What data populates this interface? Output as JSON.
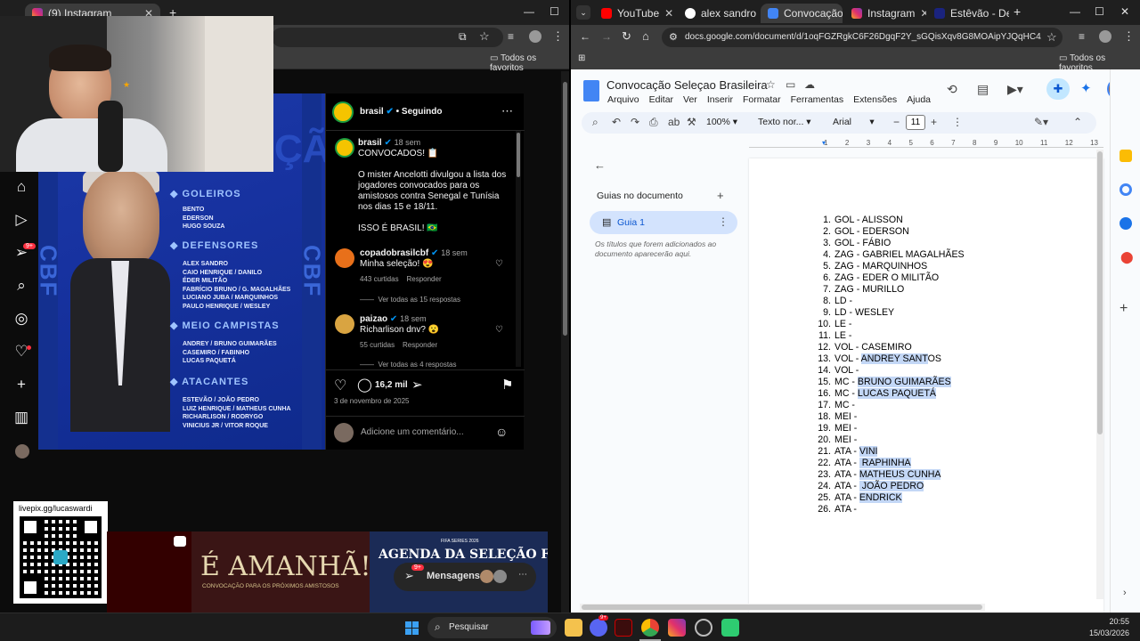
{
  "left_window": {
    "tabs": [
      {
        "label": "(9) Instagram",
        "icon": "instagram-icon"
      }
    ],
    "bookmarks": {
      "favorites_label": "Todos os favoritos"
    },
    "instagram": {
      "post_image": {
        "title_partial": "CONVOCAÇÃO",
        "side_text": "CBF",
        "sections": [
          {
            "title": "GOLEIROS",
            "players": [
              "BENTO",
              "EDERSON",
              "HUGO SOUZA"
            ]
          },
          {
            "title": "DEFENSORES",
            "players": [
              "ALEX SANDRO",
              "CAIO HENRIQUE / DANILO",
              "ÉDER MILITÃO",
              "FABRÍCIO BRUNO / G. MAGALHÃES",
              "LUCIANO JUBA / MARQUINHOS",
              "PAULO HENRIQUE / WESLEY"
            ]
          },
          {
            "title": "MEIO CAMPISTAS",
            "players": [
              "ANDREY / BRUNO GUIMARÃES",
              "CASEMIRO / FABINHO",
              "LUCAS PAQUETÁ"
            ]
          },
          {
            "title": "ATACANTES",
            "players": [
              "ESTEVÃO / JOÃO PEDRO",
              "LUIZ HENRIQUE / MATHEUS CUNHA",
              "RICHARLISON / RODRYGO",
              "VINICIUS JR / VITOR ROQUE"
            ]
          }
        ]
      },
      "header": {
        "username": "brasil",
        "following": "• Seguindo",
        "more": "⋯"
      },
      "caption": {
        "username": "brasil",
        "time": "18 sem",
        "title": "CONVOCADOS! 📋",
        "body": "O mister Ancelotti divulgou a lista dos jogadores convocados para os amistosos contra Senegal e Tunísia nos dias 15 e 18/11.",
        "footer": "ISSO É BRASIL! 🇧🇷"
      },
      "comments": [
        {
          "username": "copadobrasilcbf",
          "time": "18 sem",
          "text": "Minha seleção! 😍",
          "likes": "443 curtidas",
          "reply": "Responder",
          "view_replies": "Ver todas as 15 respostas"
        },
        {
          "username": "paizao",
          "time": "18 sem",
          "text": "Richarlison dnv? 😮",
          "likes": "55 curtidas",
          "reply": "Responder",
          "view_replies": "Ver todas as 4 respostas"
        }
      ],
      "actions": {
        "comment_count": "16,2 mil",
        "date": "3 de novembro de 2025",
        "comment_placeholder": "Adicione um comentário..."
      },
      "nav_badge": "9+"
    },
    "qr_label": "livepix.gg/lucaswardi",
    "banner": {
      "left_text": "É AMANHÃ!",
      "left_sub": "CONVOCAÇÃO PARA OS PRÓXIMOS AMISTOSOS",
      "right_top": "FIFA SERIES 2026",
      "right_text": "AGENDA DA SELEÇÃO FEMININA",
      "messages_label": "Mensagens",
      "messages_badge": "9+"
    }
  },
  "right_window": {
    "tabs": [
      {
        "label": "YouTube"
      },
      {
        "label": "alex sandro"
      },
      {
        "label": "Convocação"
      },
      {
        "label": "Instagram"
      },
      {
        "label": "Estêvão - De"
      }
    ],
    "url": "docs.google.com/document/d/1oqFGZRgkC6F26DgqF2Y_sGQisXqv8G8MOAipYJQqHC4/edit?ta...",
    "bookmarks": {
      "favorites_label": "Todos os favoritos"
    },
    "docs": {
      "title": "Convocação Seleçao Brasileira",
      "menu": [
        "Arquivo",
        "Editar",
        "Ver",
        "Inserir",
        "Formatar",
        "Ferramentas",
        "Extensões",
        "Ajuda"
      ],
      "zoom": "100%",
      "style": "Texto nor...",
      "font": "Arial",
      "font_size": "11",
      "outline_title": "Guias no documento",
      "tab_label": "Guia 1",
      "outline_hint": "Os títulos que forem adicionados ao documento aparecerão aqui.",
      "ruler": [
        "1",
        "1",
        "2",
        "3",
        "4",
        "5",
        "6",
        "7",
        "8",
        "9",
        "10",
        "11",
        "12",
        "13"
      ],
      "lines": [
        {
          "n": "1.",
          "pre": "GOL - ALISSON",
          "hl": "",
          "post": ""
        },
        {
          "n": "2.",
          "pre": "GOL - EDERSON",
          "hl": "",
          "post": ""
        },
        {
          "n": "3.",
          "pre": "GOL - FÁBIO",
          "hl": "",
          "post": ""
        },
        {
          "n": "4.",
          "pre": "ZAG - GABRIEL MAGALHÃES",
          "hl": "",
          "post": ""
        },
        {
          "n": "5.",
          "pre": "ZAG - MARQUINHOS",
          "hl": "",
          "post": ""
        },
        {
          "n": "6.",
          "pre": "ZAG - EDER O MILITÃO",
          "hl": "",
          "post": ""
        },
        {
          "n": "7.",
          "pre": "ZAG - MURILLO",
          "hl": "",
          "post": ""
        },
        {
          "n": "8.",
          "pre": "LD -",
          "hl": "",
          "post": ""
        },
        {
          "n": "9.",
          "pre": "LD - WESLEY",
          "hl": "",
          "post": ""
        },
        {
          "n": "10.",
          "pre": "LE -",
          "hl": "",
          "post": ""
        },
        {
          "n": "11.",
          "pre": "LE -",
          "hl": "",
          "post": ""
        },
        {
          "n": "12.",
          "pre": "VOL - CASEMIRO",
          "hl": "",
          "post": ""
        },
        {
          "n": "13.",
          "pre": "VOL - ",
          "hl": "ANDREY SANT",
          "post": "OS"
        },
        {
          "n": "14.",
          "pre": "VOL -",
          "hl": "",
          "post": ""
        },
        {
          "n": "15.",
          "pre": "MC - ",
          "hl": "BRUNO GUIMARÃES",
          "post": ""
        },
        {
          "n": "16.",
          "pre": "MC - ",
          "hl": "LUCAS PAQUETÁ",
          "post": ""
        },
        {
          "n": "17.",
          "pre": "MC -",
          "hl": "",
          "post": ""
        },
        {
          "n": "18.",
          "pre": "MEI -",
          "hl": "",
          "post": ""
        },
        {
          "n": "19.",
          "pre": "MEI -",
          "hl": "",
          "post": ""
        },
        {
          "n": "20.",
          "pre": "MEI -",
          "hl": "",
          "post": ""
        },
        {
          "n": "21.",
          "pre": "ATA - ",
          "hl": "VINI",
          "post": ""
        },
        {
          "n": "22.",
          "pre": "ATA - ",
          "hl": " RAPHINHA",
          "post": ""
        },
        {
          "n": "23.",
          "pre": "ATA - ",
          "hl": "MATHEUS CUNHA",
          "post": ""
        },
        {
          "n": "24.",
          "pre": "ATA - ",
          "hl": " JOÃO PEDRO",
          "post": ""
        },
        {
          "n": "25.",
          "pre": "ATA - ",
          "hl": "ENDRICK",
          "post": ""
        },
        {
          "n": "26.",
          "pre": "ATA -",
          "hl": "",
          "post": ""
        }
      ]
    }
  },
  "taskbar": {
    "search_placeholder": "Pesquisar",
    "time": "20:55",
    "date": "15/03/2026",
    "discord_badge": "9+"
  },
  "colors": {
    "ig_blue": "#0095f6",
    "docs_blue": "#1a73e8",
    "highlight": "#c3d7f6",
    "cbf_blue": "#1732a0"
  }
}
